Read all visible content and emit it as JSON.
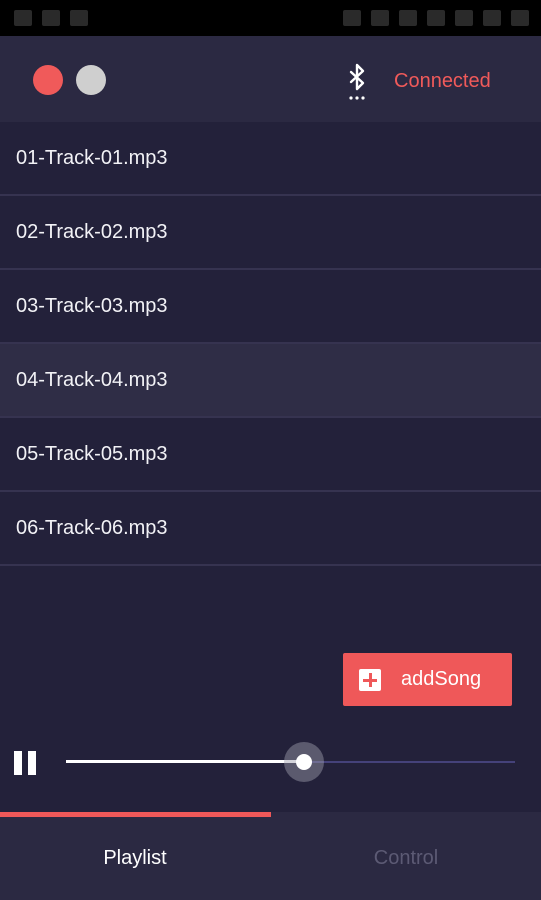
{
  "header": {
    "status_text": "Connected",
    "status_color": "#f05a5a",
    "icons": [
      "close-dot-icon",
      "minimize-dot-icon",
      "bluetooth-icon"
    ]
  },
  "playlist": {
    "tracks": [
      {
        "label": "01-Track-01.mp3"
      },
      {
        "label": "02-Track-02.mp3"
      },
      {
        "label": "03-Track-03.mp3"
      },
      {
        "label": "04-Track-04.mp3"
      },
      {
        "label": "05-Track-05.mp3"
      },
      {
        "label": "06-Track-06.mp3"
      }
    ],
    "selected_track": "04-Track-04.mp3"
  },
  "add_button": {
    "label": "addSong",
    "color": "#ef5859"
  },
  "player": {
    "state_icon": "pause-icon",
    "progress": 0.53
  },
  "tabs": {
    "playlist_label": "Playlist",
    "control_label": "Control",
    "active": "Playlist",
    "accent": "#ef5859"
  }
}
